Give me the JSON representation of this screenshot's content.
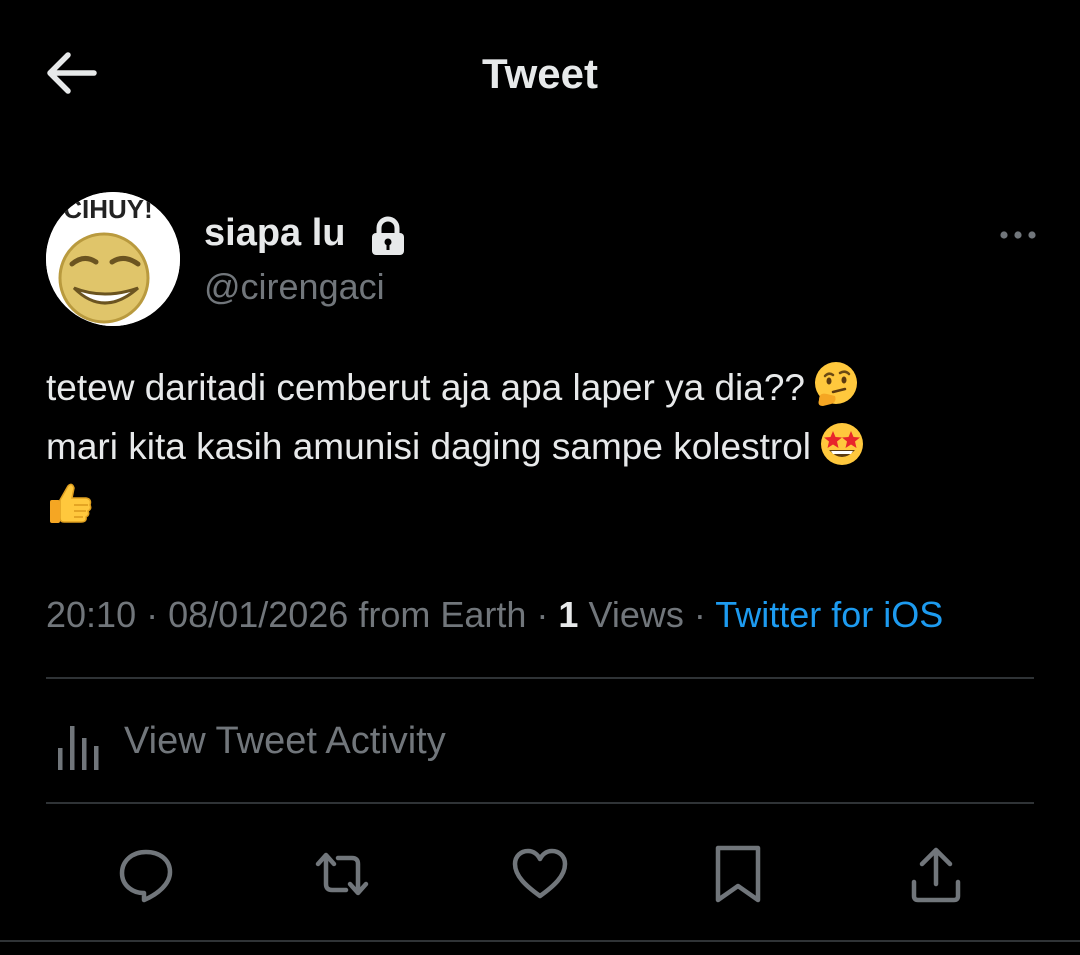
{
  "header": {
    "title": "Tweet",
    "back_icon": "arrow-left-icon"
  },
  "author": {
    "display_name": "siapa lu",
    "handle": "@cirengaci",
    "protected_icon": "lock-icon",
    "avatar_caption": "CIHUY!"
  },
  "tweet": {
    "line1": "tetew daritadi cemberut aja apa laper ya dia??",
    "line1_emoji": "thinking-face-emoji",
    "line2": "mari kita kasih amunisi daging sampe kolestrol",
    "line2_emoji": "star-struck-emoji",
    "line3_emoji": "thumbs-up-emoji"
  },
  "meta": {
    "time": "20:10",
    "sep1": "·",
    "date": "08/01/2026",
    "location": "from Earth",
    "sep2": "·",
    "views_count": "1",
    "views_label": "Views",
    "sep3": "·",
    "source": "Twitter for iOS"
  },
  "activity": {
    "label": "View Tweet Activity",
    "icon": "bar-chart-icon"
  },
  "actions": [
    {
      "icon": "reply-icon"
    },
    {
      "icon": "retweet-icon"
    },
    {
      "icon": "like-icon"
    },
    {
      "icon": "bookmark-icon"
    },
    {
      "icon": "share-icon"
    }
  ],
  "colors": {
    "background": "#000000",
    "text": "#e7e9ea",
    "secondary": "#71767b",
    "link": "#1d9bf0",
    "divider": "#2f3336"
  }
}
